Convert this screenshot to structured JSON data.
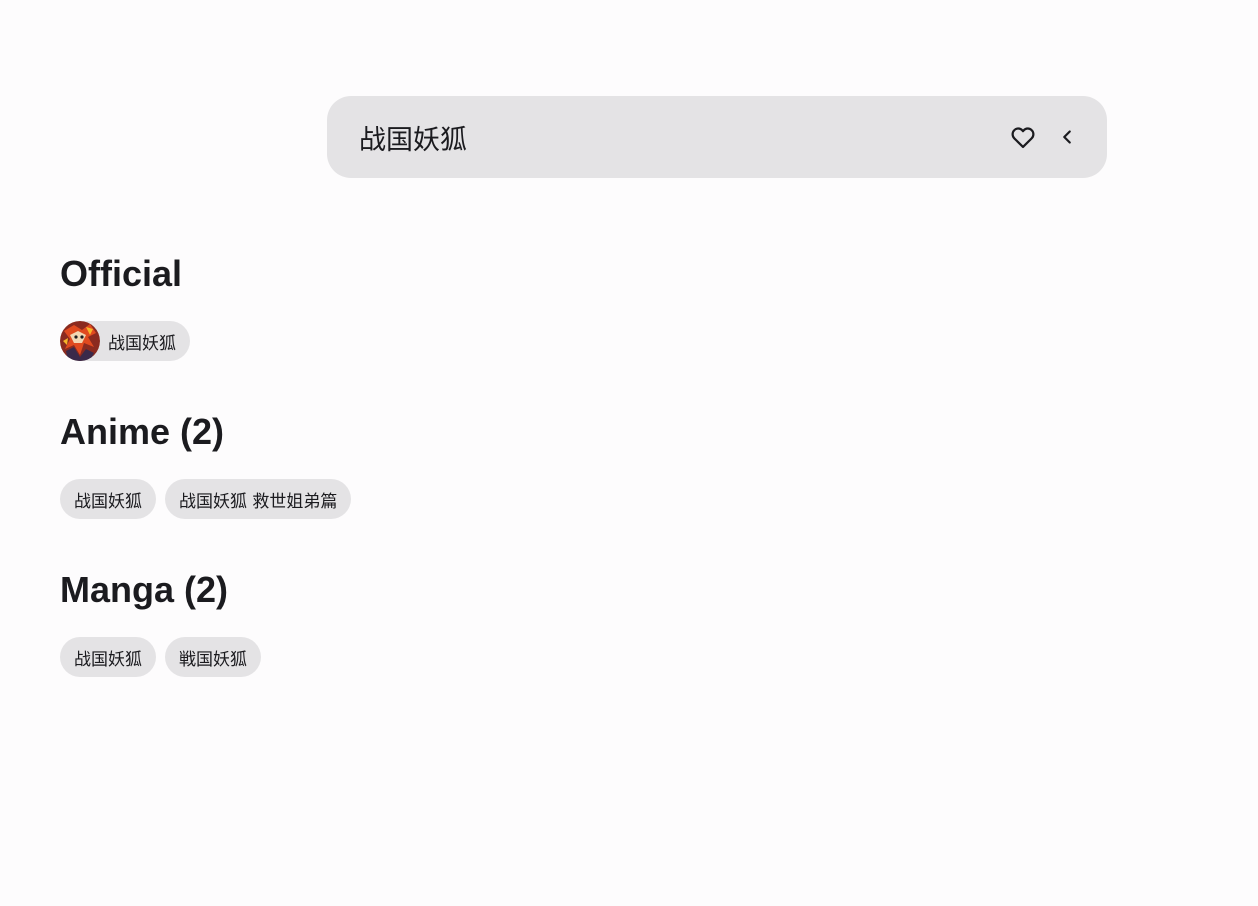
{
  "search": {
    "query": "战国妖狐",
    "favorite_icon": "heart-outline-icon",
    "back_icon": "chevron-left-icon"
  },
  "sections": {
    "official": {
      "title": "Official",
      "items": [
        {
          "label": "战国妖狐",
          "avatar": "character-avatar"
        }
      ]
    },
    "anime": {
      "title": "Anime (2)",
      "items": [
        {
          "label": "战国妖狐"
        },
        {
          "label": "战国妖狐 救世姐弟篇"
        }
      ]
    },
    "manga": {
      "title": "Manga (2)",
      "items": [
        {
          "label": "战国妖狐"
        },
        {
          "label": "戦国妖狐"
        }
      ]
    }
  },
  "colors": {
    "background": "#fdfcfd",
    "surface": "#e4e3e5",
    "text": "#1b1b1f"
  }
}
